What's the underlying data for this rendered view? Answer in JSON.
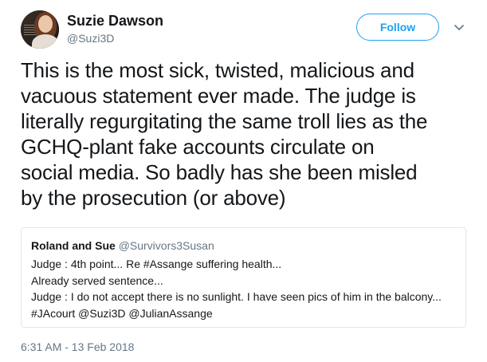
{
  "author": {
    "name": "Suzie Dawson",
    "handle": "@Suzi3D",
    "follow_label": "Follow"
  },
  "tweet": {
    "lines": [
      "This is the most sick, twisted, malicious and",
      "vacuous statement ever made. The judge is",
      "literally regurgitating the same troll lies as the",
      "GCHQ-plant fake accounts circulate on",
      "social media. So badly has she been misled",
      "by the prosecution (or above)"
    ],
    "timestamp": "6:31 AM - 13 Feb 2018"
  },
  "quoted": {
    "name": "Roland and Sue",
    "handle": "@Survivors3Susan",
    "lines": [
      "Judge : 4th point... Re #Assange suffering health...",
      "Already served sentence...",
      "Judge : I do not accept there is no sunlight.  I have seen pics of him in the balcony...",
      "#JAcourt @Suzi3D @JulianAssange"
    ]
  },
  "icons": {
    "avatar": "profile-photo",
    "menu": "chevron-down-icon"
  },
  "colors": {
    "accent": "#1da1f2",
    "secondary_text": "#657786",
    "border": "#e1e8ed"
  }
}
